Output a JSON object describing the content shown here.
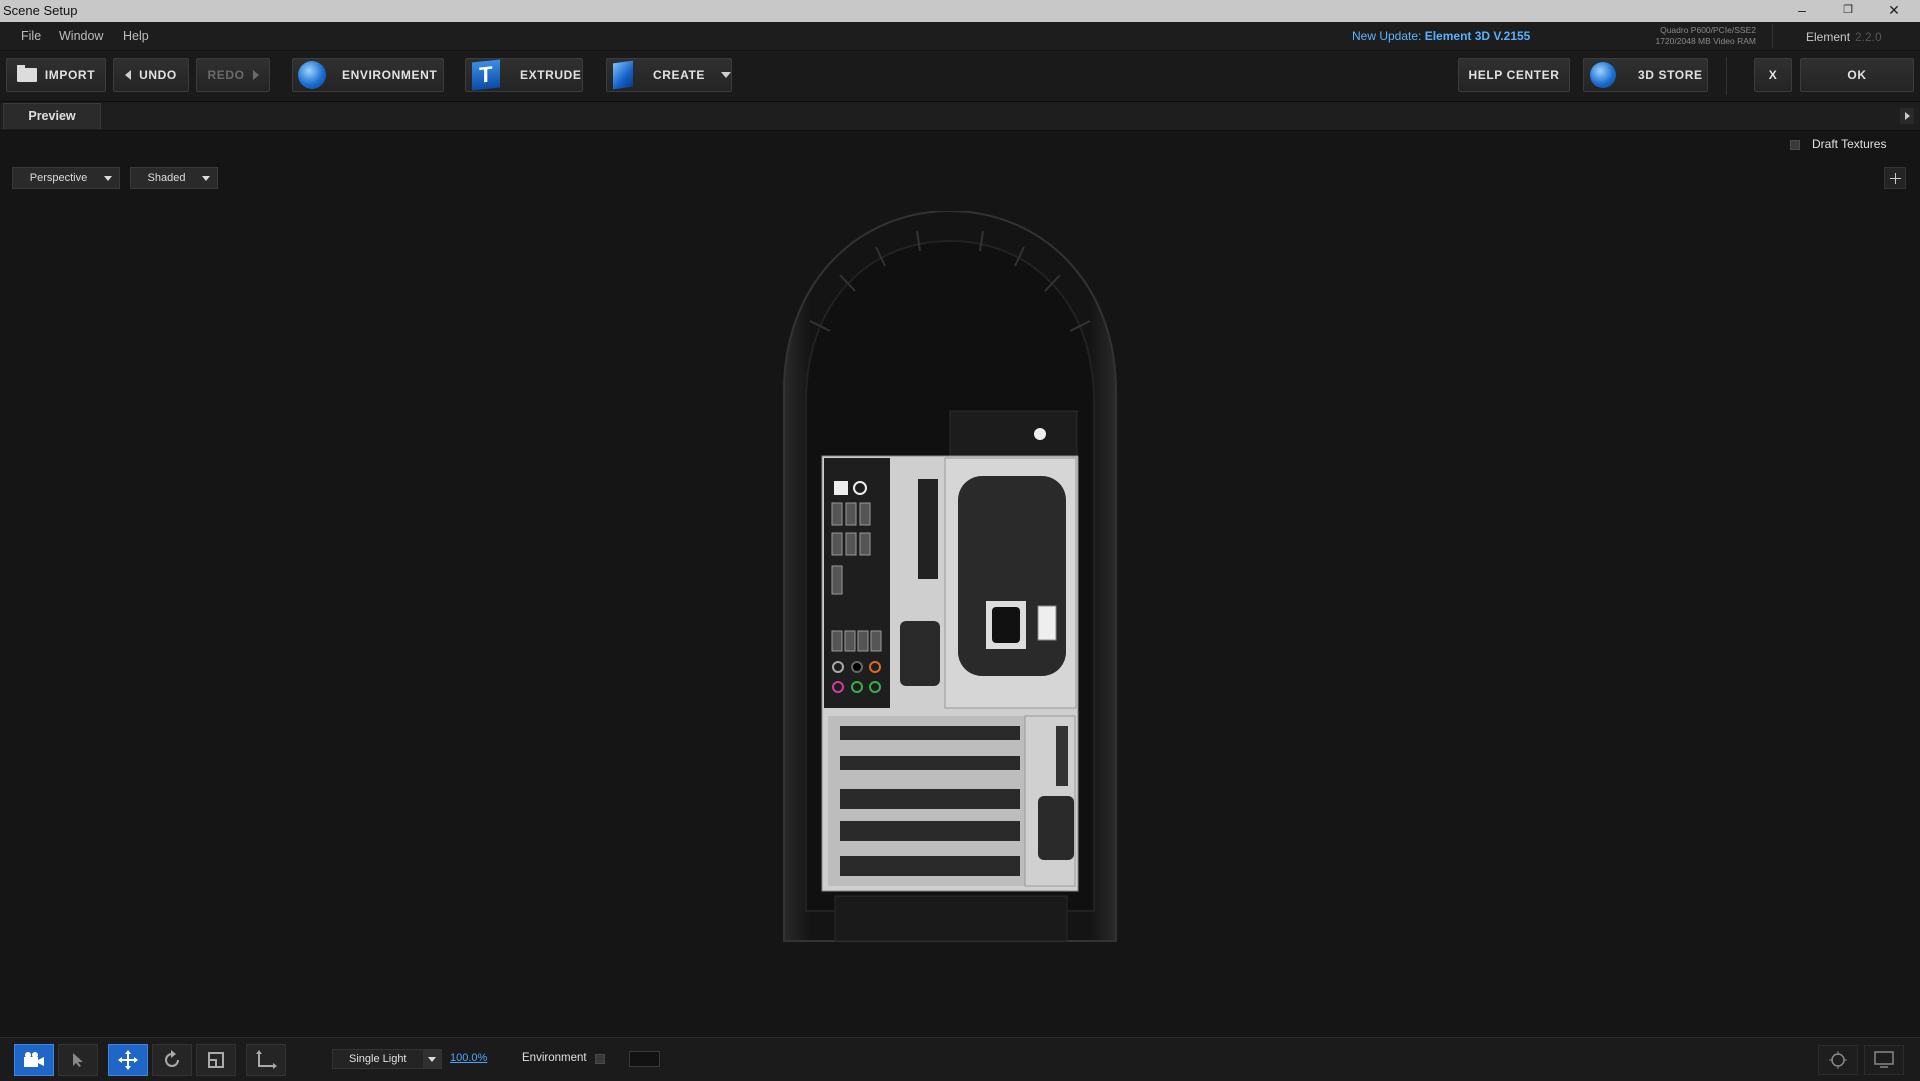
{
  "window": {
    "title": "Scene Setup",
    "minimize": "–",
    "restore": "❐",
    "close": "✕"
  },
  "menu": {
    "items": [
      "File",
      "Window",
      "Help"
    ]
  },
  "update": {
    "prefix": "New Update:",
    "product": "Element 3D V.2155"
  },
  "gpu": {
    "line1": "Quadro P600/PCIe/SSE2",
    "line2": "1720/2048 MB Video RAM"
  },
  "plugin": {
    "name": "Element",
    "version": "2.2.0"
  },
  "toolbar": {
    "import": "IMPORT",
    "undo": "UNDO",
    "redo": "REDO",
    "environment": "ENVIRONMENT",
    "extrude": "EXTRUDE",
    "create": "CREATE",
    "help_center": "HELP CENTER",
    "store": "3D STORE",
    "close": "X",
    "ok": "OK"
  },
  "preview": {
    "tab": "Preview"
  },
  "viewport": {
    "draft_textures": "Draft Textures",
    "camera_view": "Perspective",
    "shading": "Shaded"
  },
  "bottom": {
    "lighting": "Single Light",
    "zoom": "100.0%",
    "environment": "Environment"
  },
  "colors": {
    "accent": "#1f66c6",
    "link": "#4ea7ff",
    "background": "#151515"
  }
}
